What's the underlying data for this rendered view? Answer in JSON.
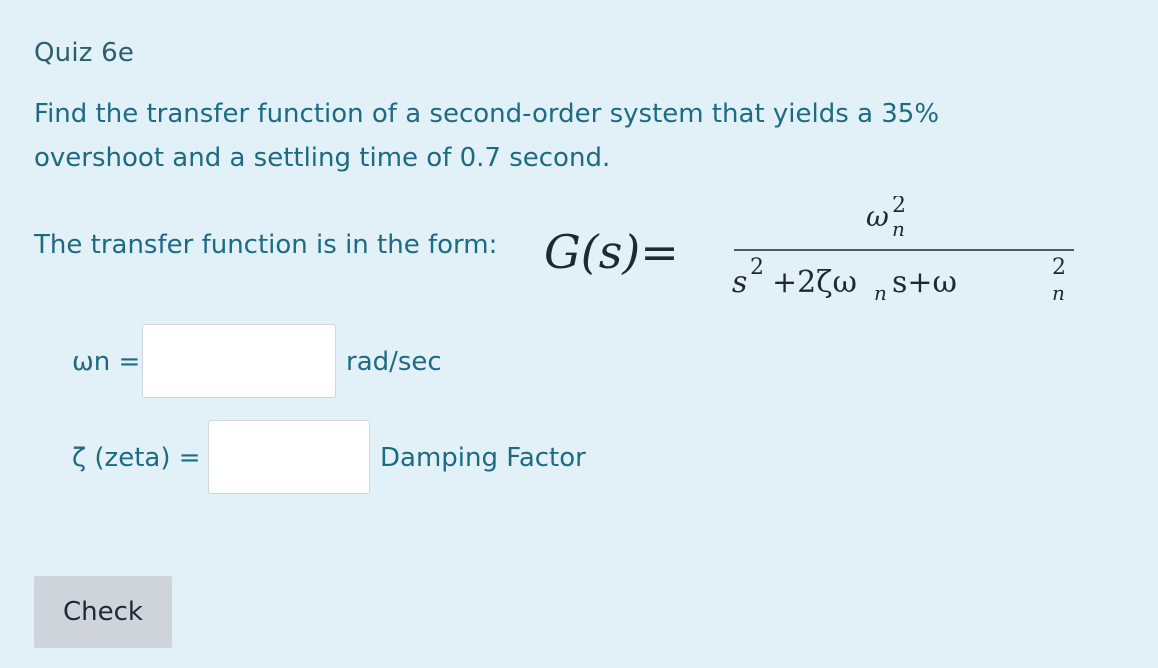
{
  "quiz": {
    "title": "Quiz 6e",
    "question": "Find the transfer function of a second-order system that yields a 35% overshoot and a settling time of 0.7 second.",
    "form_intro": "The transfer function is in the form:"
  },
  "formula": {
    "lhs": "G(s)=",
    "numerator_base": "ω",
    "numerator_sup": "2",
    "numerator_sub": "n",
    "denominator_parts": [
      "s",
      "2",
      "+2ζω",
      "n",
      "s+ω",
      "2",
      "n"
    ]
  },
  "fields": {
    "wn_label": "ωn =",
    "wn_value": "",
    "wn_unit": "rad/sec",
    "zeta_label": "ζ (zeta) =",
    "zeta_value": "",
    "zeta_unit": "Damping Factor"
  },
  "actions": {
    "check_label": "Check"
  },
  "colors": {
    "background": "#e2f0f8",
    "text": "#1c6b83",
    "button": "#ced4d9"
  }
}
